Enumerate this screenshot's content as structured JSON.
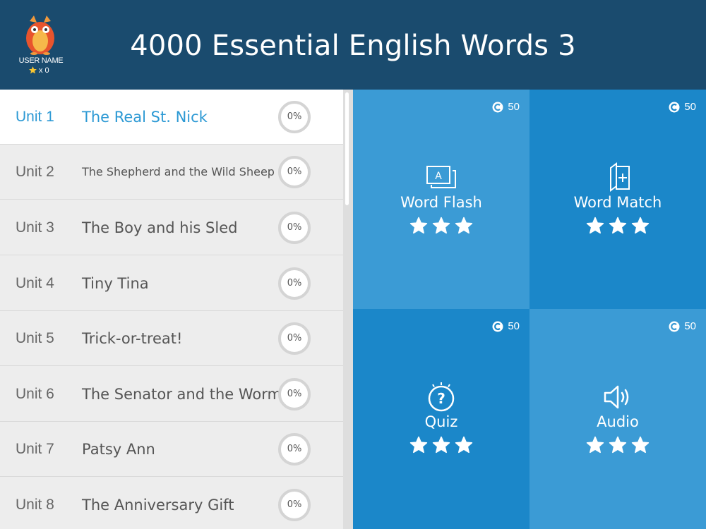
{
  "header": {
    "title": "4000 Essential English Words 3",
    "user_name": "USER NAME",
    "star_count": "x 0"
  },
  "units": [
    {
      "num": "Unit 1",
      "title": "The Real St. Nick",
      "progress": "0%",
      "active": true
    },
    {
      "num": "Unit 2",
      "title": "The Shepherd and the Wild Sheep",
      "progress": "0%",
      "active": false
    },
    {
      "num": "Unit 3",
      "title": "The Boy and his Sled",
      "progress": "0%",
      "active": false
    },
    {
      "num": "Unit 4",
      "title": "Tiny Tina",
      "progress": "0%",
      "active": false
    },
    {
      "num": "Unit 5",
      "title": "Trick-or-treat!",
      "progress": "0%",
      "active": false
    },
    {
      "num": "Unit 6",
      "title": "The Senator and the Worm",
      "progress": "0%",
      "active": false
    },
    {
      "num": "Unit 7",
      "title": "Patsy Ann",
      "progress": "0%",
      "active": false
    },
    {
      "num": "Unit 8",
      "title": "The Anniversary Gift",
      "progress": "0%",
      "active": false
    }
  ],
  "activities": [
    {
      "label": "Word Flash",
      "coins": "50",
      "icon": "word-flash-icon",
      "stars": 3
    },
    {
      "label": "Word Match",
      "coins": "50",
      "icon": "word-match-icon",
      "stars": 3
    },
    {
      "label": "Quiz",
      "coins": "50",
      "icon": "quiz-icon",
      "stars": 3
    },
    {
      "label": "Audio",
      "coins": "50",
      "icon": "audio-icon",
      "stars": 3
    }
  ],
  "colors": {
    "header_bg": "#1a4b6e",
    "accent": "#2c99d4",
    "tile_light": "#3b9bd5",
    "tile_dark": "#1b87c9"
  }
}
